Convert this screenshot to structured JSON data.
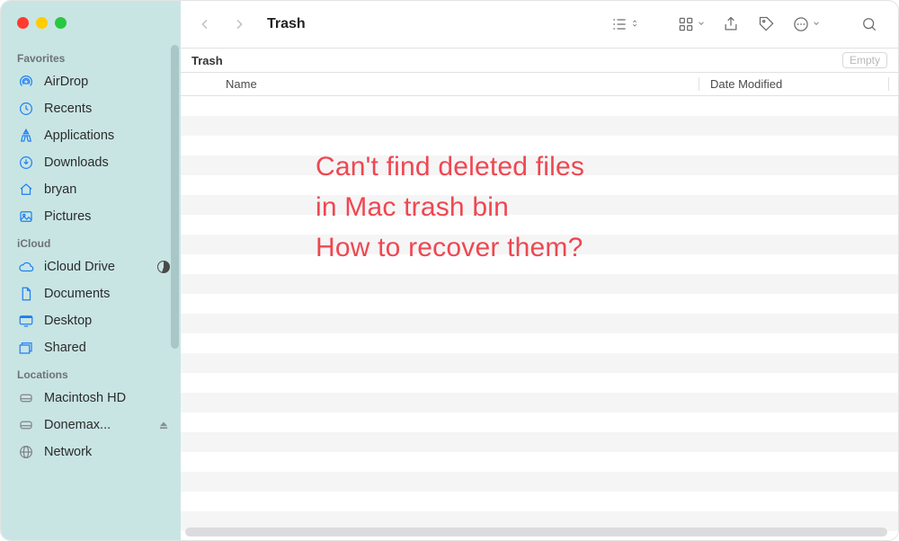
{
  "window": {
    "title": "Trash"
  },
  "location": {
    "label": "Trash",
    "empty_button": "Empty"
  },
  "columns": {
    "name": "Name",
    "date": "Date Modified"
  },
  "sidebar": {
    "groups": [
      {
        "title": "Favorites",
        "items": [
          {
            "icon": "airdrop-icon",
            "label": "AirDrop"
          },
          {
            "icon": "clock-icon",
            "label": "Recents"
          },
          {
            "icon": "apps-icon",
            "label": "Applications"
          },
          {
            "icon": "download-icon",
            "label": "Downloads"
          },
          {
            "icon": "home-icon",
            "label": "bryan"
          },
          {
            "icon": "pictures-icon",
            "label": "Pictures"
          }
        ]
      },
      {
        "title": "iCloud",
        "items": [
          {
            "icon": "cloud-icon",
            "label": "iCloud Drive",
            "badge": "pie"
          },
          {
            "icon": "doc-icon",
            "label": "Documents"
          },
          {
            "icon": "desktop-icon",
            "label": "Desktop"
          },
          {
            "icon": "shared-icon",
            "label": "Shared"
          }
        ]
      },
      {
        "title": "Locations",
        "items": [
          {
            "icon": "disk-icon",
            "label": "Macintosh HD"
          },
          {
            "icon": "disk-icon",
            "label": "Donemax...",
            "badge": "eject"
          },
          {
            "icon": "globe-icon",
            "label": "Network"
          }
        ]
      }
    ]
  },
  "overlay": {
    "line1": "Can't find deleted files",
    "line2": "in Mac trash bin",
    "line3": "How to recover them?"
  }
}
